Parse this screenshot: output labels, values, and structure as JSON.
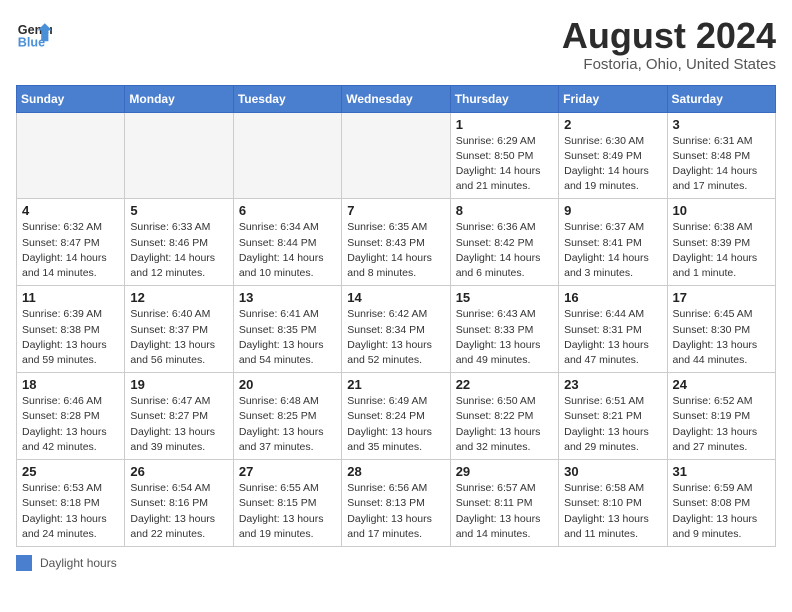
{
  "header": {
    "logo_line1": "General",
    "logo_line2": "Blue",
    "month_year": "August 2024",
    "location": "Fostoria, Ohio, United States"
  },
  "days_of_week": [
    "Sunday",
    "Monday",
    "Tuesday",
    "Wednesday",
    "Thursday",
    "Friday",
    "Saturday"
  ],
  "footer": {
    "legend_label": "Daylight hours"
  },
  "weeks": [
    [
      {
        "day": "",
        "info": ""
      },
      {
        "day": "",
        "info": ""
      },
      {
        "day": "",
        "info": ""
      },
      {
        "day": "",
        "info": ""
      },
      {
        "day": "1",
        "info": "Sunrise: 6:29 AM\nSunset: 8:50 PM\nDaylight: 14 hours\nand 21 minutes."
      },
      {
        "day": "2",
        "info": "Sunrise: 6:30 AM\nSunset: 8:49 PM\nDaylight: 14 hours\nand 19 minutes."
      },
      {
        "day": "3",
        "info": "Sunrise: 6:31 AM\nSunset: 8:48 PM\nDaylight: 14 hours\nand 17 minutes."
      }
    ],
    [
      {
        "day": "4",
        "info": "Sunrise: 6:32 AM\nSunset: 8:47 PM\nDaylight: 14 hours\nand 14 minutes."
      },
      {
        "day": "5",
        "info": "Sunrise: 6:33 AM\nSunset: 8:46 PM\nDaylight: 14 hours\nand 12 minutes."
      },
      {
        "day": "6",
        "info": "Sunrise: 6:34 AM\nSunset: 8:44 PM\nDaylight: 14 hours\nand 10 minutes."
      },
      {
        "day": "7",
        "info": "Sunrise: 6:35 AM\nSunset: 8:43 PM\nDaylight: 14 hours\nand 8 minutes."
      },
      {
        "day": "8",
        "info": "Sunrise: 6:36 AM\nSunset: 8:42 PM\nDaylight: 14 hours\nand 6 minutes."
      },
      {
        "day": "9",
        "info": "Sunrise: 6:37 AM\nSunset: 8:41 PM\nDaylight: 14 hours\nand 3 minutes."
      },
      {
        "day": "10",
        "info": "Sunrise: 6:38 AM\nSunset: 8:39 PM\nDaylight: 14 hours\nand 1 minute."
      }
    ],
    [
      {
        "day": "11",
        "info": "Sunrise: 6:39 AM\nSunset: 8:38 PM\nDaylight: 13 hours\nand 59 minutes."
      },
      {
        "day": "12",
        "info": "Sunrise: 6:40 AM\nSunset: 8:37 PM\nDaylight: 13 hours\nand 56 minutes."
      },
      {
        "day": "13",
        "info": "Sunrise: 6:41 AM\nSunset: 8:35 PM\nDaylight: 13 hours\nand 54 minutes."
      },
      {
        "day": "14",
        "info": "Sunrise: 6:42 AM\nSunset: 8:34 PM\nDaylight: 13 hours\nand 52 minutes."
      },
      {
        "day": "15",
        "info": "Sunrise: 6:43 AM\nSunset: 8:33 PM\nDaylight: 13 hours\nand 49 minutes."
      },
      {
        "day": "16",
        "info": "Sunrise: 6:44 AM\nSunset: 8:31 PM\nDaylight: 13 hours\nand 47 minutes."
      },
      {
        "day": "17",
        "info": "Sunrise: 6:45 AM\nSunset: 8:30 PM\nDaylight: 13 hours\nand 44 minutes."
      }
    ],
    [
      {
        "day": "18",
        "info": "Sunrise: 6:46 AM\nSunset: 8:28 PM\nDaylight: 13 hours\nand 42 minutes."
      },
      {
        "day": "19",
        "info": "Sunrise: 6:47 AM\nSunset: 8:27 PM\nDaylight: 13 hours\nand 39 minutes."
      },
      {
        "day": "20",
        "info": "Sunrise: 6:48 AM\nSunset: 8:25 PM\nDaylight: 13 hours\nand 37 minutes."
      },
      {
        "day": "21",
        "info": "Sunrise: 6:49 AM\nSunset: 8:24 PM\nDaylight: 13 hours\nand 35 minutes."
      },
      {
        "day": "22",
        "info": "Sunrise: 6:50 AM\nSunset: 8:22 PM\nDaylight: 13 hours\nand 32 minutes."
      },
      {
        "day": "23",
        "info": "Sunrise: 6:51 AM\nSunset: 8:21 PM\nDaylight: 13 hours\nand 29 minutes."
      },
      {
        "day": "24",
        "info": "Sunrise: 6:52 AM\nSunset: 8:19 PM\nDaylight: 13 hours\nand 27 minutes."
      }
    ],
    [
      {
        "day": "25",
        "info": "Sunrise: 6:53 AM\nSunset: 8:18 PM\nDaylight: 13 hours\nand 24 minutes."
      },
      {
        "day": "26",
        "info": "Sunrise: 6:54 AM\nSunset: 8:16 PM\nDaylight: 13 hours\nand 22 minutes."
      },
      {
        "day": "27",
        "info": "Sunrise: 6:55 AM\nSunset: 8:15 PM\nDaylight: 13 hours\nand 19 minutes."
      },
      {
        "day": "28",
        "info": "Sunrise: 6:56 AM\nSunset: 8:13 PM\nDaylight: 13 hours\nand 17 minutes."
      },
      {
        "day": "29",
        "info": "Sunrise: 6:57 AM\nSunset: 8:11 PM\nDaylight: 13 hours\nand 14 minutes."
      },
      {
        "day": "30",
        "info": "Sunrise: 6:58 AM\nSunset: 8:10 PM\nDaylight: 13 hours\nand 11 minutes."
      },
      {
        "day": "31",
        "info": "Sunrise: 6:59 AM\nSunset: 8:08 PM\nDaylight: 13 hours\nand 9 minutes."
      }
    ]
  ]
}
